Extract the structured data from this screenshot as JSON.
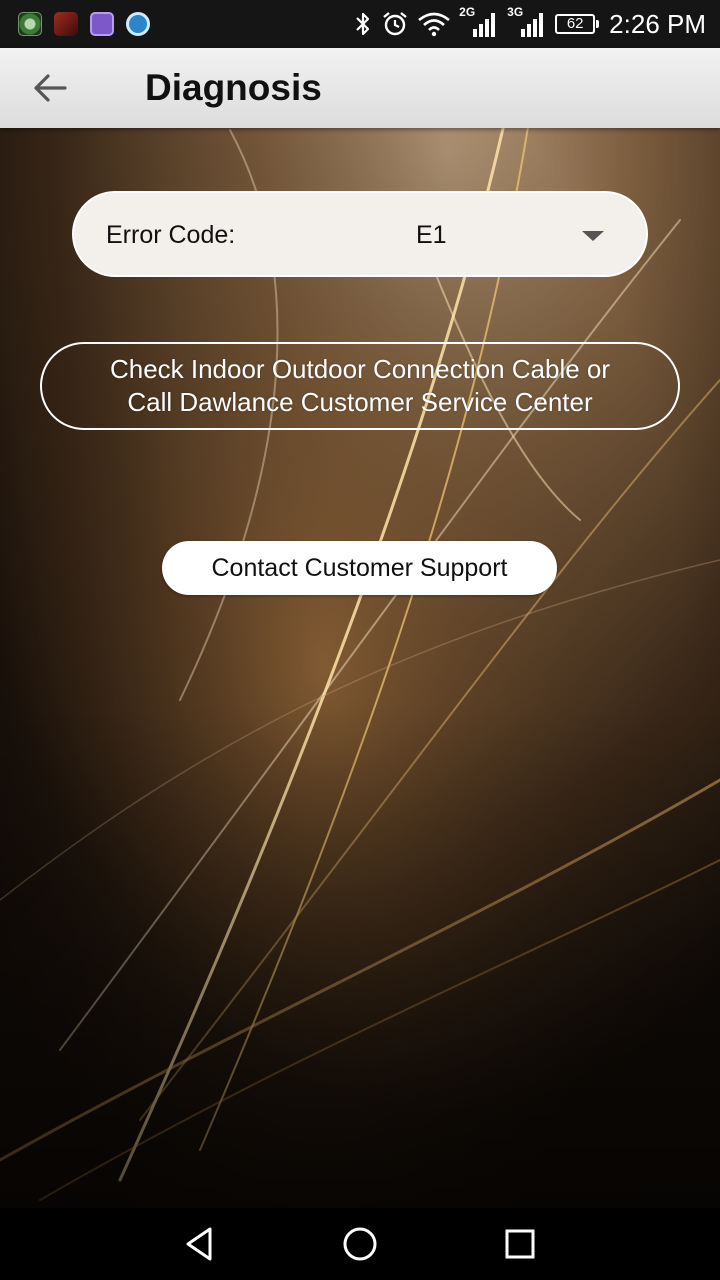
{
  "status_bar": {
    "time": "2:26 PM",
    "battery": "62",
    "network_2g": "2G",
    "network_3g": "3G"
  },
  "app_bar": {
    "title": "Diagnosis"
  },
  "diagnosis": {
    "error_label": "Error Code:",
    "error_value": "E1",
    "message": "Check Indoor Outdoor Connection Cable or\nCall Dawlance Customer Service Center",
    "contact_button": "Contact Customer Support"
  },
  "colors": {
    "app_bar": "#e8e8e8",
    "status_bar": "#151515",
    "nav_bar": "#000000",
    "accent_gold": "#d7a24f"
  }
}
